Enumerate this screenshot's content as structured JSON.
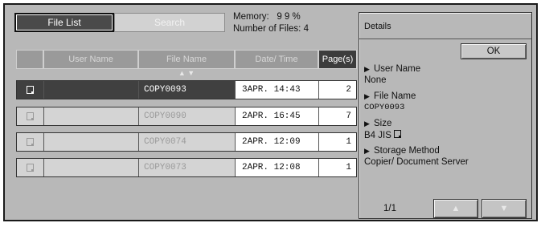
{
  "tabs": {
    "file_list": "File List",
    "search": "Search"
  },
  "status": {
    "memory_label": "Memory:",
    "memory_value": "9 9 %",
    "files_label": "Number of Files:",
    "files_value": "4"
  },
  "columns": {
    "user_name": "User Name",
    "file_name": "File Name",
    "date_time": "Date/ Time",
    "pages": "Page(s)"
  },
  "sort_arrows": "▲ ▼",
  "rows": [
    {
      "user": "",
      "file": "COPY0093",
      "date": "3APR.  14:43",
      "pages": "2",
      "selected": true
    },
    {
      "user": "",
      "file": "COPY0090",
      "date": "2APR.  16:45",
      "pages": "7",
      "selected": false
    },
    {
      "user": "",
      "file": "COPY0074",
      "date": "2APR.  12:09",
      "pages": "1",
      "selected": false
    },
    {
      "user": "",
      "file": "COPY0073",
      "date": "2APR.  12:08",
      "pages": "1",
      "selected": false
    }
  ],
  "details": {
    "title": "Details",
    "ok": "OK",
    "user_name_label": "User Name",
    "user_name_value": "None",
    "file_name_label": "File Name",
    "file_name_value": "COPY0093",
    "size_label": "Size",
    "size_value": "B4 JIS",
    "storage_label": "Storage Method",
    "storage_value": "Copier/ Document Server",
    "page_indicator": "1/1",
    "up_arrow": "▲",
    "down_arrow": "▼"
  },
  "colors": {
    "selected_row": "#404040",
    "panel_bg": "#b8b8b8"
  }
}
